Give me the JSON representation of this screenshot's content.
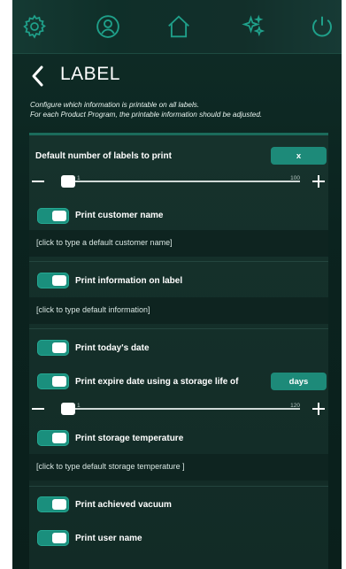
{
  "nav": {
    "items": [
      {
        "icon": "gear-icon"
      },
      {
        "icon": "user-icon"
      },
      {
        "icon": "home-icon"
      },
      {
        "icon": "sparkle-icon"
      },
      {
        "icon": "power-icon"
      }
    ],
    "accent": "#1fa08a"
  },
  "header": {
    "title": "LABEL",
    "description_line1": "Configure which information is printable on all labels.",
    "description_line2": "For each Product Program, the printable information should be adjusted."
  },
  "settings": {
    "default_labels": {
      "label": "Default number of labels to print",
      "button_label": "x",
      "slider_min": "1",
      "slider_max": "100",
      "slider_value": 1
    },
    "customer_name": {
      "label": "Print customer name",
      "enabled": true,
      "placeholder": "[click to type a default customer name]"
    },
    "info_on_label": {
      "label": "Print information on label",
      "enabled": true,
      "placeholder": "[click to type default information]"
    },
    "todays_date": {
      "label": "Print today's date",
      "enabled": true
    },
    "expire_date": {
      "label": "Print expire date using a storage life of",
      "enabled": true,
      "button_label": "days",
      "slider_min": "1",
      "slider_max": "120",
      "slider_value": 1
    },
    "storage_temperature": {
      "label": "Print storage temperature",
      "enabled": true,
      "placeholder": "[click to type default storage temperature ]"
    },
    "achieved_vacuum": {
      "label": "Print achieved vacuum",
      "enabled": true
    },
    "user_name": {
      "label": "Print user name",
      "enabled": true
    }
  }
}
